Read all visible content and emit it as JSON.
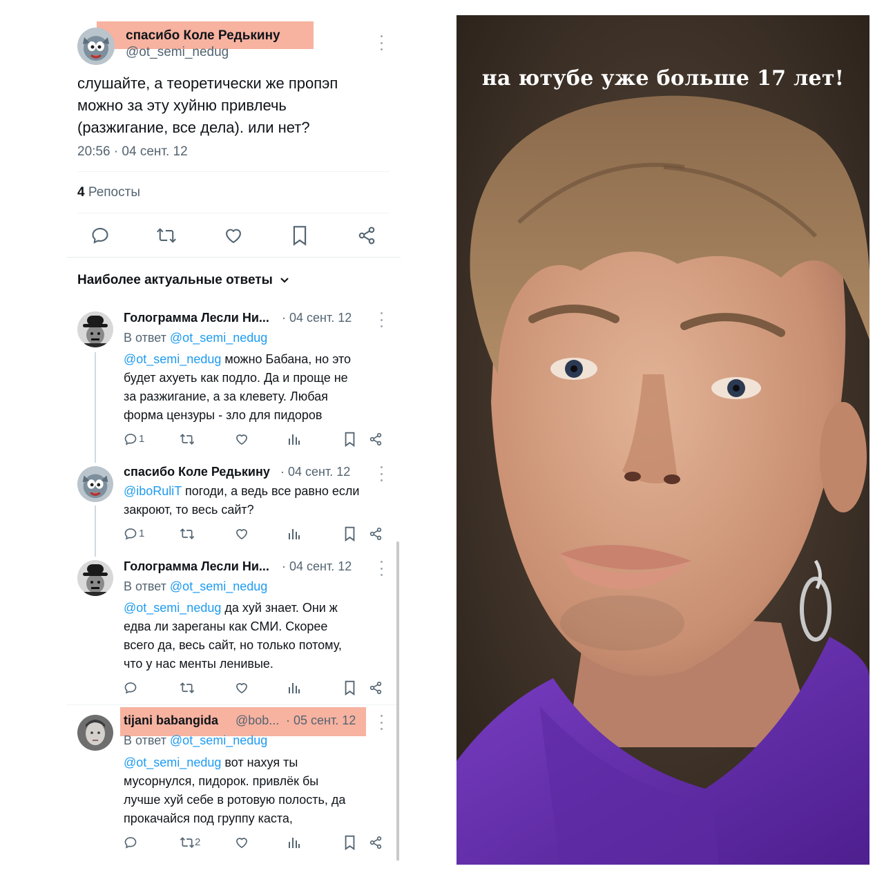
{
  "colors": {
    "link": "#1d9bf0",
    "text": "#0f1419",
    "muted": "#536471",
    "highlight": "#f7b2a0",
    "hoodie": "#6b2fb3"
  },
  "main_tweet": {
    "display_name": "спасибо Коле Редькину",
    "handle": "@ot_semi_nedug",
    "text_lines": [
      "слушайте, а теоретически же пропэп",
      "можно за эту хуйню привлечь",
      "(разжигание, все дела). или нет?"
    ],
    "timestamp": "20:56 · 04 сент. 12",
    "reposts_count": "4",
    "reposts_label": "Репосты",
    "actions": [
      "reply-icon",
      "repost-icon",
      "like-icon",
      "bookmark-icon",
      "share-icon"
    ]
  },
  "replies_header": {
    "label": "Наиболее актуальные ответы"
  },
  "replies": [
    {
      "display_name": "Голограмма Лесли Ни...",
      "date": "· 04 сент. 12",
      "reply_prefix": "В ответ",
      "reply_to": "@ot_semi_nedug",
      "mention": "@ot_semi_nedug",
      "first_line_rest": " можно Бабана, но это",
      "lines": [
        "будет ахуеть как подло. Да и проще не",
        "за разжигание, а за клевету. Любая",
        "форма цензуры - зло для пидоров"
      ],
      "reply_count": "1",
      "repost_count": ""
    },
    {
      "display_name": "спасибо Коле Редькину",
      "date": "· 04 сент. 12",
      "mention": "@iboRuliT",
      "first_line_rest": " погоди, а ведь все равно если",
      "lines": [
        "закроют, то весь сайт?"
      ],
      "reply_count": "1",
      "repost_count": ""
    },
    {
      "display_name": "Голограмма Лесли Ни...",
      "date": "· 04 сент. 12",
      "reply_prefix": "В ответ",
      "reply_to": "@ot_semi_nedug",
      "mention": "@ot_semi_nedug",
      "first_line_rest": " да хуй знает. Они ж",
      "lines": [
        "едва ли зареганы как СМИ. Скорее",
        "всего да, весь сайт, но только потому,",
        "что у нас менты ленивые."
      ],
      "reply_count": "",
      "repost_count": ""
    },
    {
      "display_name": "tijani babangida",
      "handle": "@bob...",
      "date": "· 05 сент. 12",
      "reply_prefix": "В ответ",
      "reply_to": "@ot_semi_nedug",
      "mention": "@ot_semi_nedug",
      "first_line_rest": " вот нахуя ты",
      "lines": [
        "мусорнулся, пидорок. привлёк бы",
        "лучше хуй себе в ротовую полость, да",
        "прокачайся под группу каста,"
      ],
      "reply_count": "",
      "repost_count": "2"
    }
  ],
  "photo": {
    "caption": "на ютубе уже больше 17 лет!"
  }
}
